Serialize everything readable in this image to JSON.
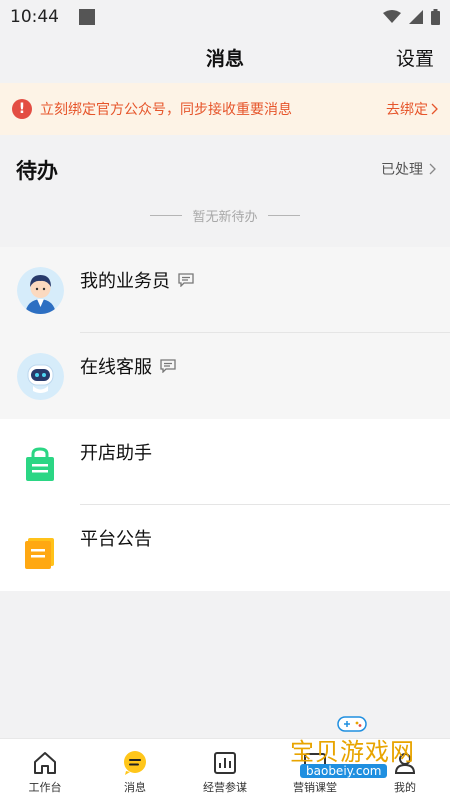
{
  "status_bar": {
    "time": "10:44"
  },
  "header": {
    "title": "消息",
    "settings_label": "设置"
  },
  "notice": {
    "text": "立刻绑定官方公众号，同步接收重要消息",
    "link": "去绑定",
    "icon": "alert-icon",
    "color": "#e6552b"
  },
  "todo": {
    "title": "待办",
    "processed_link": "已处理",
    "empty_text": "暂无新待办"
  },
  "chats": [
    {
      "label": "我的业务员",
      "icon": "salesperson-avatar",
      "has_message_icon": true
    },
    {
      "label": "在线客服",
      "icon": "robot-avatar",
      "has_message_icon": true
    }
  ],
  "tools": [
    {
      "label": "开店助手",
      "icon": "shop-bag-icon"
    },
    {
      "label": "平台公告",
      "icon": "notice-board-icon"
    }
  ],
  "tabbar": [
    {
      "label": "工作台",
      "icon": "home-icon",
      "active": false
    },
    {
      "label": "消息",
      "icon": "message-icon",
      "active": true
    },
    {
      "label": "经营参谋",
      "icon": "chart-icon",
      "active": false
    },
    {
      "label": "营销课堂",
      "icon": "classroom-icon",
      "active": false
    },
    {
      "label": "我的",
      "icon": "profile-icon",
      "active": false
    }
  ],
  "watermark": {
    "text": "宝贝游戏网",
    "url": "baobeiy.com"
  }
}
